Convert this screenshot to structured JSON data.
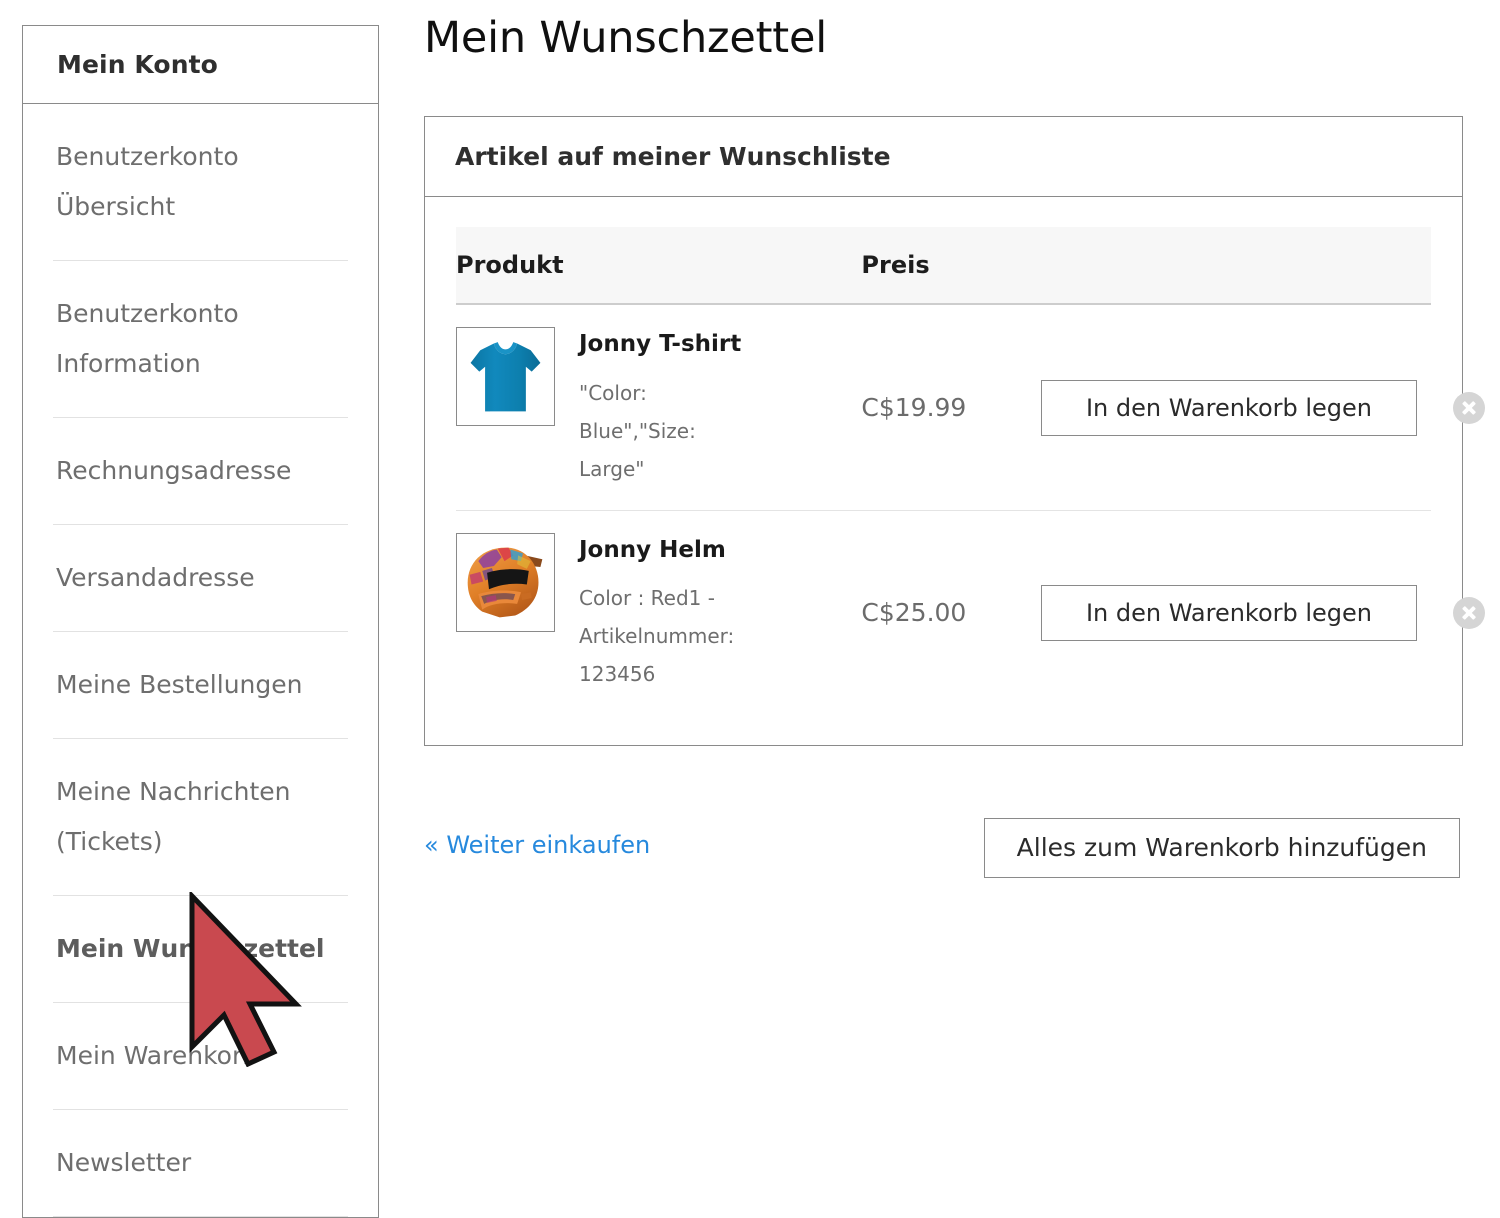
{
  "page": {
    "title": "Mein Wunschzettel"
  },
  "sidebar": {
    "header": "Mein Konto",
    "items": [
      {
        "label": "Benutzerkonto Übersicht",
        "active": false
      },
      {
        "label": "Benutzerkonto Information",
        "active": false
      },
      {
        "label": "Rechnungsadresse",
        "active": false
      },
      {
        "label": "Versandadresse",
        "active": false
      },
      {
        "label": "Meine Bestellungen",
        "active": false
      },
      {
        "label": "Meine Nachrichten (Tickets)",
        "active": false
      },
      {
        "label": "Mein Wunschzettel",
        "active": true
      },
      {
        "label": "Mein Warenkorb",
        "active": false
      },
      {
        "label": "Newsletter",
        "active": false
      }
    ]
  },
  "panel": {
    "title": "Artikel auf meiner Wunschliste",
    "table": {
      "columns": [
        "Produkt",
        "Preis",
        "",
        ""
      ],
      "rows": [
        {
          "name": "Jonny T-shirt",
          "options": "\"Color: Blue\",\"Size: Large\"",
          "price": "C$19.99",
          "add_to_cart_label": "In den Warenkorb legen",
          "thumb": "blue-tshirt",
          "remove_icon": "remove-circle-icon"
        },
        {
          "name": "Jonny Helm",
          "options": "Color : Red1 - Artikelnummer: 123456",
          "price": "C$25.00",
          "add_to_cart_label": "In den Warenkorb legen",
          "thumb": "motocross-helmet",
          "remove_icon": "remove-circle-icon"
        }
      ]
    }
  },
  "actions": {
    "continue_shopping": "« Weiter einkaufen",
    "add_all_to_cart": "Alles zum Warenkorb hinzufügen"
  },
  "colors": {
    "link": "#2689dd",
    "border": "#8a8a8a",
    "divider": "#e2e2e2",
    "table_head_bg": "#f7f7f7",
    "muted_text": "#6e6e6e",
    "cursor": "#c9494f",
    "tshirt": "#0e7fae",
    "helmet_orange": "#e8862a"
  },
  "cursor": {
    "icon": "mouse-pointer-arrow"
  }
}
